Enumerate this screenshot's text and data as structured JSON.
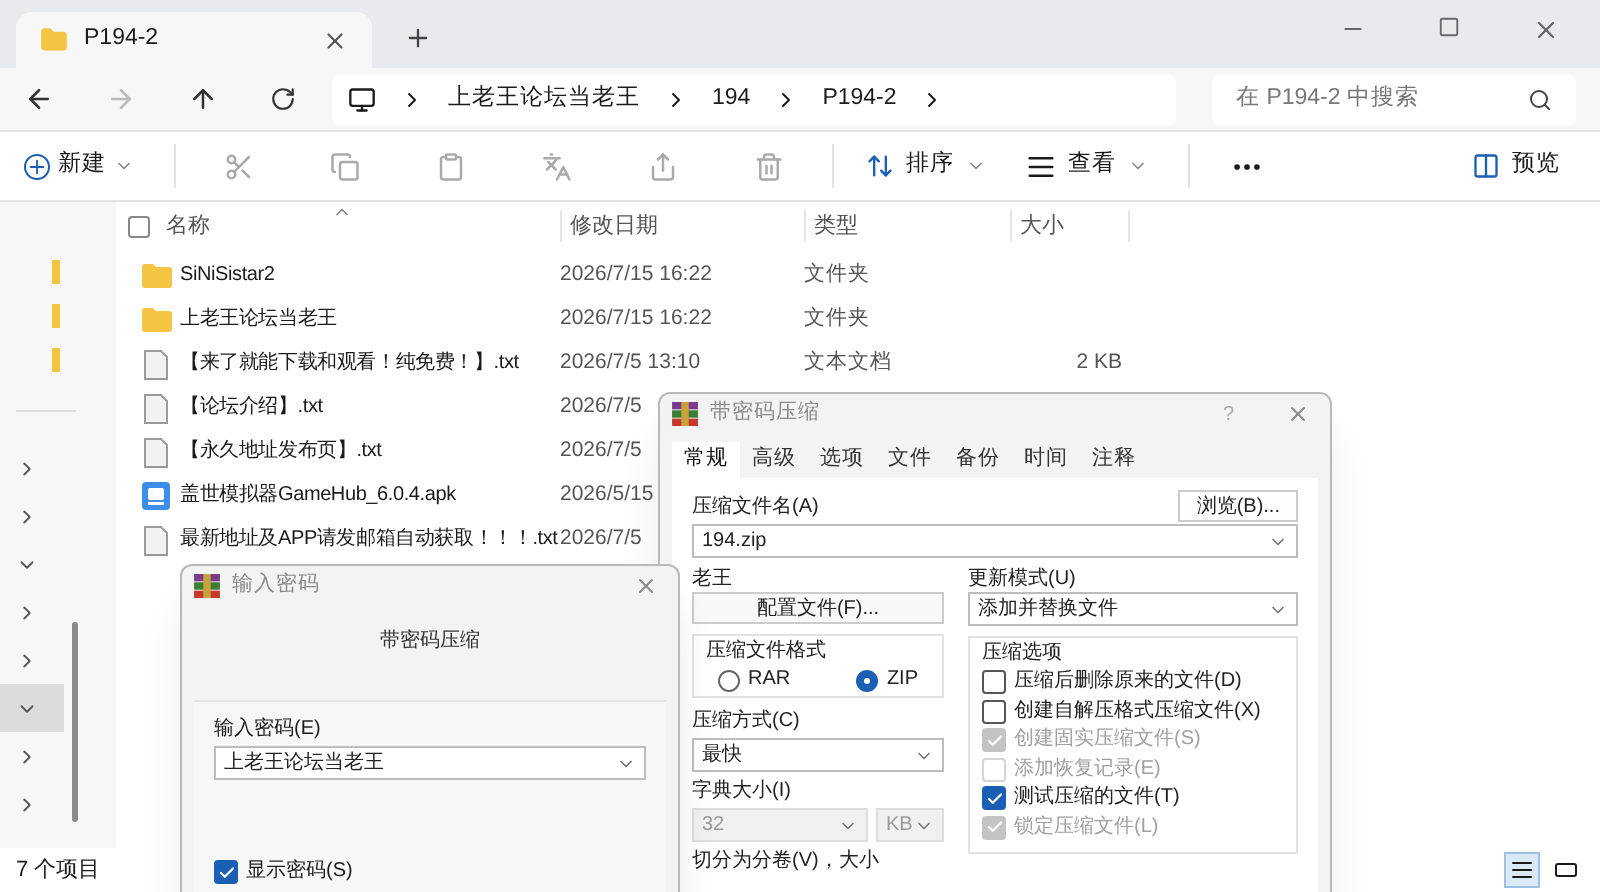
{
  "window": {
    "tab_title": "P194-2"
  },
  "breadcrumb": [
    "上老王论坛当老王",
    "194",
    "P194-2"
  ],
  "search": {
    "placeholder": "在 P194-2 中搜索"
  },
  "toolbar": {
    "new": "新建",
    "sort": "排序",
    "view": "查看",
    "preview": "预览"
  },
  "select_all": {
    "checked": false
  },
  "columns": [
    "名称",
    "修改日期",
    "类型",
    "大小"
  ],
  "files": [
    {
      "kind": "folder",
      "name": "SiNiSistar2",
      "date": "2026/7/15 16:22",
      "type": "文件夹"
    },
    {
      "kind": "folder",
      "name": "上老王论坛当老王",
      "date": "2026/7/15 16:22",
      "type": "文件夹"
    },
    {
      "kind": "text",
      "name": "【来了就能下载和观看！纯免费！】.txt",
      "date": "2026/7/5 13:10",
      "type": "文本文档",
      "size": "2 KB"
    },
    {
      "kind": "text",
      "name": "【论坛介绍】.txt",
      "date": "2026/7/5"
    },
    {
      "kind": "text",
      "name": "【永久地址发布页】.txt",
      "date": "2026/7/5"
    },
    {
      "kind": "app",
      "name": "盖世模拟器GameHub_6.0.4.apk",
      "date": "2026/5/15"
    },
    {
      "kind": "text",
      "name": "最新地址及APP请发邮箱自动获取！！！.txt",
      "date": "2026/7/5"
    }
  ],
  "nav_items": [
    {
      "expanded": false,
      "selected": false
    },
    {
      "expanded": false,
      "selected": false
    },
    {
      "expanded": true,
      "selected": false
    },
    {
      "expanded": false,
      "selected": false
    },
    {
      "expanded": false,
      "selected": false
    },
    {
      "expanded": true,
      "selected": true
    },
    {
      "expanded": false,
      "selected": false
    },
    {
      "expanded": false,
      "selected": false
    }
  ],
  "status_bar": {
    "count": "7 个项目",
    "views": [
      {
        "selected": true
      },
      {
        "selected": false
      }
    ]
  },
  "archive_dialog": {
    "title": "带密码压缩",
    "help": "?",
    "tabs": [
      {
        "label": "常规",
        "selected": true
      },
      {
        "label": "高级",
        "selected": false
      },
      {
        "label": "选项",
        "selected": false
      },
      {
        "label": "文件",
        "selected": false
      },
      {
        "label": "备份",
        "selected": false
      },
      {
        "label": "时间",
        "selected": false
      },
      {
        "label": "注释",
        "selected": false
      }
    ],
    "archive_name_label": "压缩文件名(A)",
    "browse": "浏览(B)...",
    "archive_name": "194.zip",
    "profile_label": "老王",
    "profile_button": "配置文件(F)...",
    "update_mode_label": "更新模式(U)",
    "update_mode": "添加并替换文件",
    "format_label": "压缩文件格式",
    "formats": [
      {
        "label": "RAR",
        "selected": false
      },
      {
        "label": "ZIP",
        "selected": true
      }
    ],
    "method_label": "压缩方式(C)",
    "method": "最快",
    "dict_label": "字典大小(I)",
    "dict_value": "32",
    "dict_unit": "KB",
    "dict_disabled": true,
    "split_label": "切分为分卷(V)，大小",
    "options_label": "压缩选项",
    "options": [
      {
        "label": "压缩后删除原来的文件(D)",
        "checked": false,
        "disabled": false
      },
      {
        "label": "创建自解压格式压缩文件(X)",
        "checked": false,
        "disabled": false
      },
      {
        "label": "创建固实压缩文件(S)",
        "checked": true,
        "disabled": true
      },
      {
        "label": "添加恢复记录(E)",
        "checked": false,
        "disabled": true
      },
      {
        "label": "测试压缩的文件(T)",
        "checked": true,
        "disabled": false
      },
      {
        "label": "锁定压缩文件(L)",
        "checked": true,
        "disabled": true
      }
    ]
  },
  "password_dialog": {
    "title": "输入密码",
    "heading": "带密码压缩",
    "label": "输入密码(E)",
    "value": "上老王论坛当老王",
    "show_password": {
      "label": "显示密码(S)",
      "checked": true
    }
  }
}
